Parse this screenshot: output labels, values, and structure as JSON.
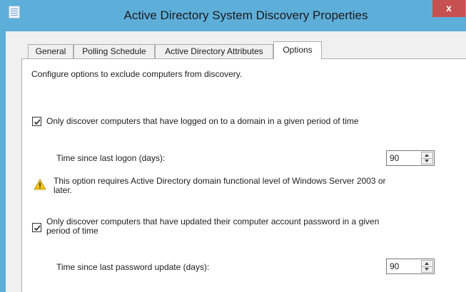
{
  "window": {
    "title": "Active Directory System Discovery Properties",
    "close_label": "x"
  },
  "tabs": [
    {
      "label": "General"
    },
    {
      "label": "Polling Schedule"
    },
    {
      "label": "Active Directory Attributes"
    },
    {
      "label": "Options"
    }
  ],
  "options": {
    "intro": "Configure options to exclude computers from discovery.",
    "logon_checkbox": {
      "label": "Only discover computers that have logged on to a domain in a given period of time",
      "checked": true
    },
    "logon_days_label": "Time since last logon (days):",
    "logon_days_value": "90",
    "warning_line1": "This option requires Active Directory domain functional level of Windows Server 2003 or",
    "warning_line2": "later.",
    "password_checkbox": {
      "label_line1": "Only discover computers that have updated their computer account password in a given",
      "label_line2": "period of time",
      "checked": true
    },
    "password_days_label": "Time since last password update (days):",
    "password_days_value": "90"
  },
  "colors": {
    "titlebar": "#5eaeda",
    "close": "#c75050",
    "warning": "#f2c511"
  }
}
